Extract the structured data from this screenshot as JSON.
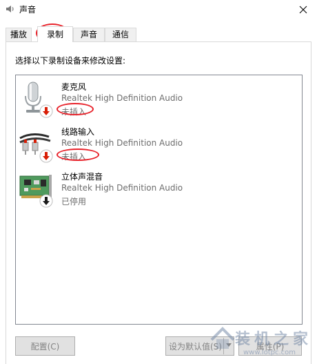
{
  "window": {
    "title": "声音"
  },
  "tabs": [
    {
      "label": "播放"
    },
    {
      "label": "录制"
    },
    {
      "label": "声音"
    },
    {
      "label": "通信"
    }
  ],
  "active_tab": "录制",
  "instruction": "选择以下录制设备来修改设置:",
  "devices": [
    {
      "name": "麦克风",
      "driver": "Realtek High Definition Audio",
      "status": "未插入",
      "icon": "microphone-icon",
      "badge": "red-down-arrow"
    },
    {
      "name": "线路输入",
      "driver": "Realtek High Definition Audio",
      "status": "未插入",
      "icon": "line-in-cable-icon",
      "badge": "red-down-arrow"
    },
    {
      "name": "立体声混音",
      "driver": "Realtek High Definition Audio",
      "status": "已停用",
      "icon": "sound-card-icon",
      "badge": "black-down-arrow"
    }
  ],
  "buttons": {
    "configure": "配置(C)",
    "set_default": "设为默认值(S)",
    "properties": "属性(P)"
  },
  "watermark": {
    "text": "装机之家",
    "url": "www.lotpc.com"
  },
  "colors": {
    "annotation": "#e8222a",
    "status_gray": "#6d6d6d",
    "badge_red": "#d81e06",
    "disabled_text": "#838383"
  }
}
